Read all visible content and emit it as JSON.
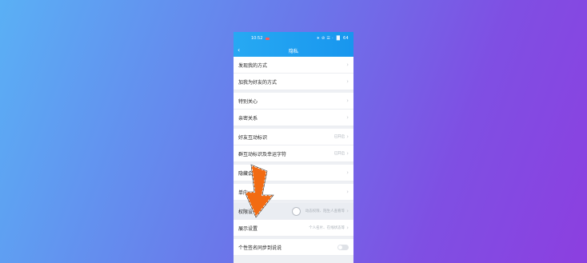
{
  "status_bar": {
    "time": "10:52",
    "icons": "∗ ⊘ ☰ · ▐▌ 64"
  },
  "header": {
    "title": "隐私",
    "back": "‹"
  },
  "rows": [
    {
      "label": "发现我的方式",
      "hint": ""
    },
    {
      "label": "加我为好友的方式",
      "hint": ""
    },
    {
      "label": "特别关心",
      "hint": ""
    },
    {
      "label": "亲密关系",
      "hint": ""
    },
    {
      "label": "好友互动标识",
      "hint": "已开启"
    },
    {
      "label": "群互动标识及幸运字符",
      "hint": "已开启"
    },
    {
      "label": "隐藏会",
      "hint": ""
    },
    {
      "label": "单向",
      "hint": ""
    },
    {
      "label": "权限设置",
      "hint": "动态权限、陌生人查看等"
    },
    {
      "label": "展示设置",
      "hint": "个人名片、在线状态等"
    },
    {
      "label": "个性签名同步到说说",
      "hint": ""
    }
  ],
  "chevron": "›",
  "colors": {
    "header": "#1896ee",
    "arrow": "#f26b12"
  },
  "toggles": {
    "signature_sync": false
  }
}
